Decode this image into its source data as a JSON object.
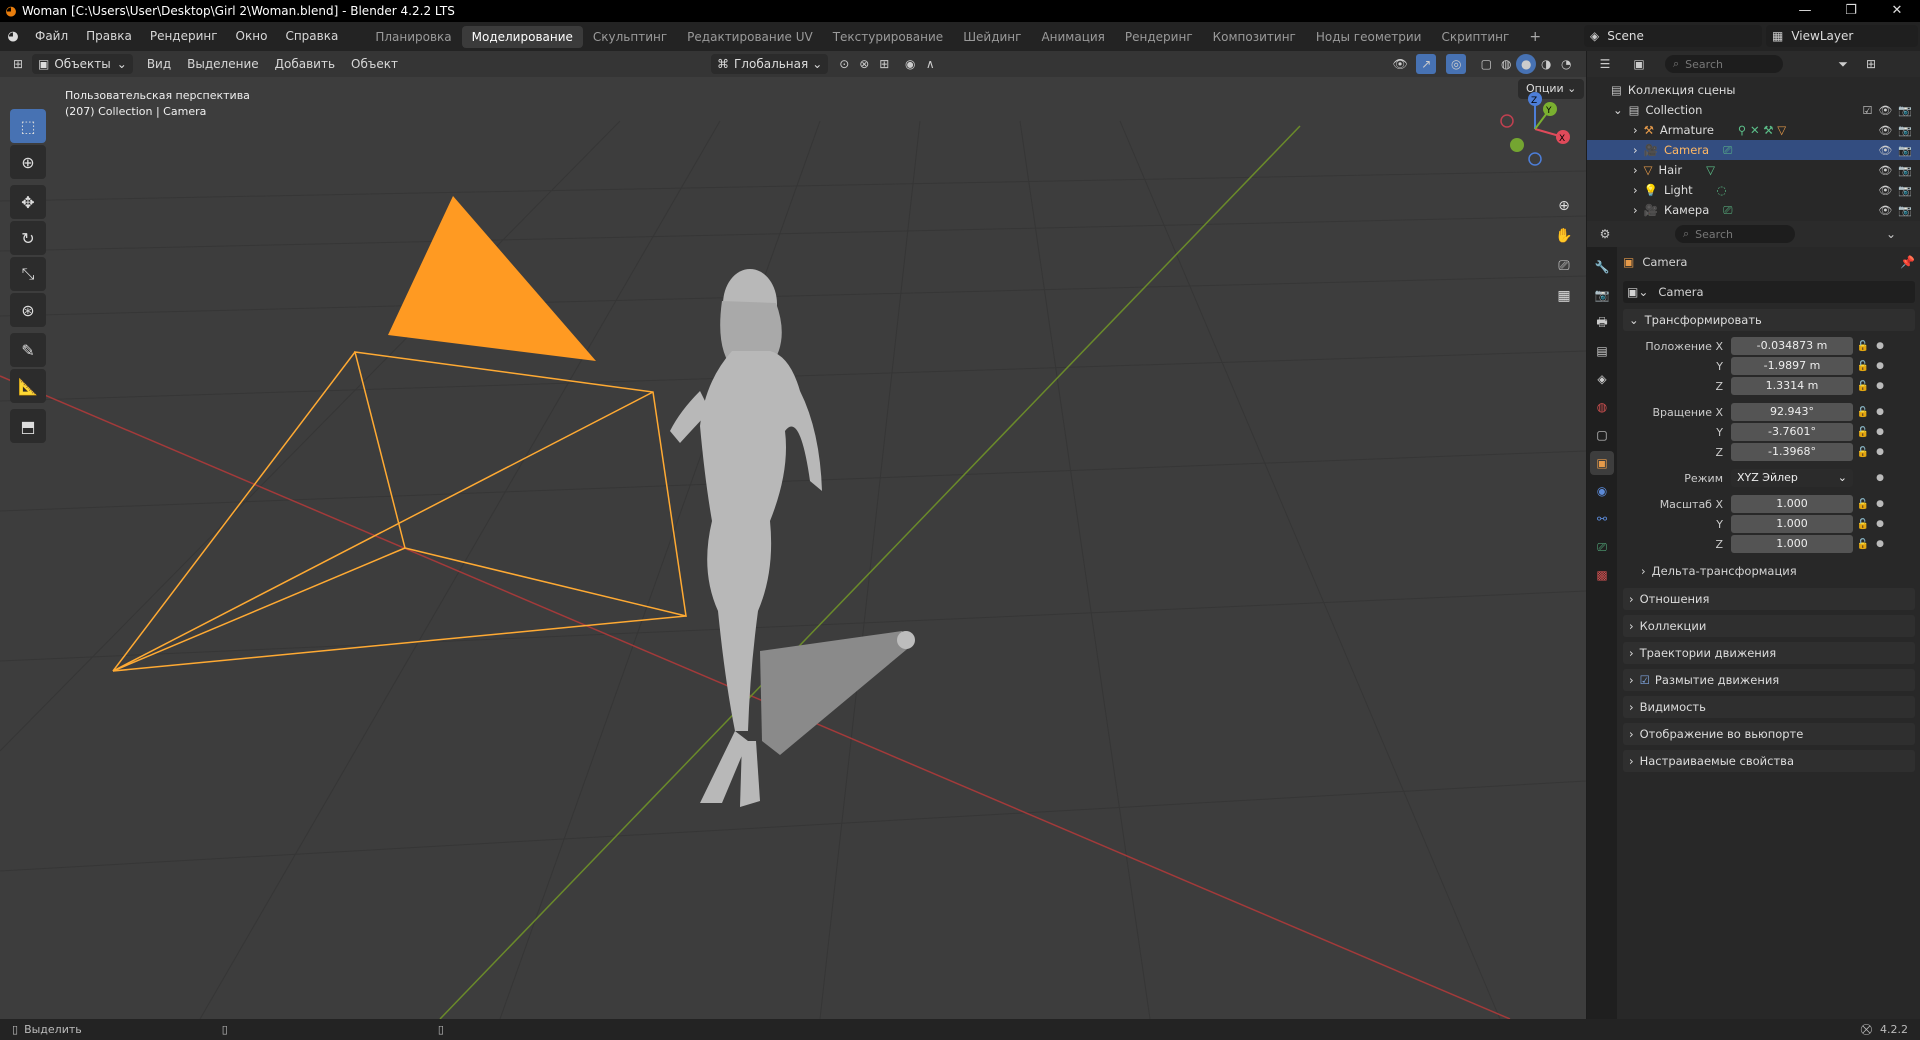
{
  "window": {
    "title": "Woman [C:\\Users\\User\\Desktop\\Girl 2\\Woman.blend] - Blender 4.2.2 LTS",
    "min": "—",
    "max": "❐",
    "close": "✕"
  },
  "menu": [
    "Файл",
    "Правка",
    "Рендеринг",
    "Окно",
    "Справка"
  ],
  "workspaces": [
    "Планировка",
    "Моделирование",
    "Скульптинг",
    "Редактирование UV",
    "Текстурирование",
    "Шейдинг",
    "Анимация",
    "Рендеринг",
    "Композитинг",
    "Ноды геометрии",
    "Скриптинг"
  ],
  "active_workspace": "Моделирование",
  "scene": {
    "name": "Scene",
    "view_layer": "ViewLayer"
  },
  "viewport": {
    "mode": "Объекты",
    "menus": [
      "Вид",
      "Выделение",
      "Добавить",
      "Объект"
    ],
    "orientation": "Глобальная",
    "options": "Опции",
    "view_name": "Пользовательская перспектива",
    "collection_info": "(207) Collection | Camera",
    "gizmo": {
      "x": "X",
      "y": "Y",
      "z": "Z"
    }
  },
  "outliner": {
    "search_placeholder": "Search",
    "root": "Коллекция сцены",
    "collection": "Collection",
    "items": [
      {
        "name": "Armature",
        "selected": false,
        "color": "#e59a4a"
      },
      {
        "name": "Camera",
        "selected": true,
        "color": "#e59a4a"
      },
      {
        "name": "Hair",
        "selected": false,
        "color": "#e59a4a"
      },
      {
        "name": "Light",
        "selected": false,
        "color": "#e59a4a"
      },
      {
        "name": "Камера",
        "selected": false,
        "color": "#e59a4a"
      }
    ]
  },
  "properties": {
    "search_placeholder": "Search",
    "object_title": "Camera",
    "object_name": "Camera",
    "transform_label": "Трансформировать",
    "location_label": "Положение X",
    "location": [
      "-0.034873 m",
      "-1.9897 m",
      "1.3314 m"
    ],
    "rotation_label": "Вращение X",
    "rotation": [
      "92.943°",
      "-3.7601°",
      "-1.3968°"
    ],
    "mode_label": "Режим",
    "mode_value": "XYZ Эйлер",
    "scale_label": "Масштаб X",
    "scale": [
      "1.000",
      "1.000",
      "1.000"
    ],
    "axis_y": "Y",
    "axis_z": "Z",
    "delta": "Дельта-трансформация",
    "sections": [
      "Отношения",
      "Коллекции",
      "Траектории движения",
      "Размытие движения",
      "Видимость",
      "Отображение во вьюпорте",
      "Настраиваемые свойства"
    ]
  },
  "status": {
    "left": "Выделить",
    "version": "4.2.2"
  }
}
